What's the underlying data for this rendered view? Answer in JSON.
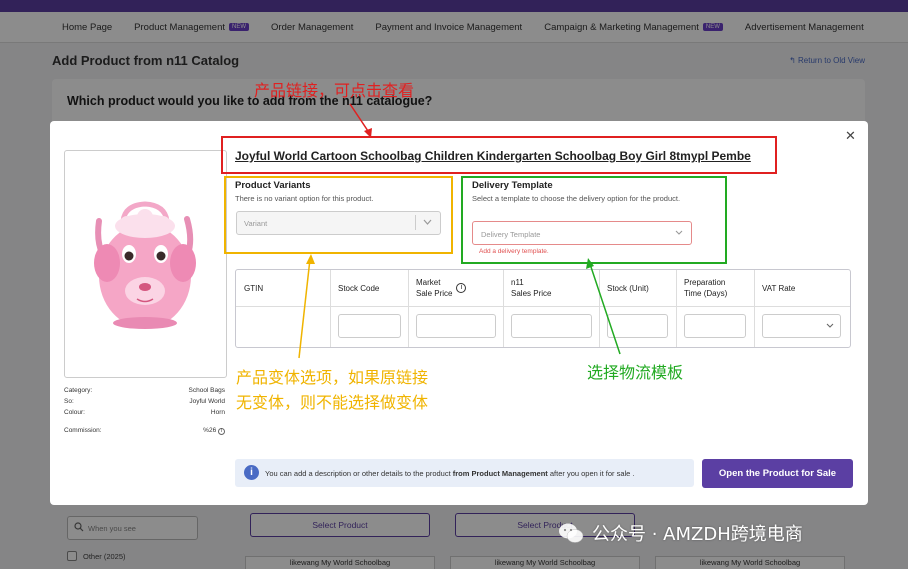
{
  "nav": {
    "items": [
      {
        "label": "Home Page",
        "badge": ""
      },
      {
        "label": "Product Management",
        "badge": "NEW"
      },
      {
        "label": "Order Management",
        "badge": ""
      },
      {
        "label": "Payment and Invoice Management",
        "badge": ""
      },
      {
        "label": "Campaign & Marketing Management",
        "badge": "NEW"
      },
      {
        "label": "Advertisement Management",
        "badge": ""
      }
    ]
  },
  "page": {
    "title": "Add Product from n11 Catalog",
    "return_link": "Return to Old View",
    "question": "Which product would you like to add from the n11 catalogue?"
  },
  "background": {
    "search_placeholder": "When you see",
    "filter_option": "Other (2025)",
    "select_product_label": "Select Product",
    "item_label": "likewang My World Schoolbag"
  },
  "modal": {
    "product_title": "Joyful World Cartoon Schoolbag Children Kindergarten Schoolbag Boy Girl 8tmypl Pembe",
    "meta": [
      {
        "label": "Category:",
        "value": "School Bags"
      },
      {
        "label": "So:",
        "value": "Joyful World"
      },
      {
        "label": "Colour:",
        "value": "Horn"
      },
      {
        "label": "Commission:",
        "value": "%26"
      }
    ],
    "variants": {
      "title": "Product Variants",
      "description": "There is no variant option for this product.",
      "placeholder": "Variant"
    },
    "delivery": {
      "title": "Delivery Template",
      "description": "Select a template to choose the delivery option for the product.",
      "placeholder": "Delivery Template",
      "error": "Add a delivery template."
    },
    "table": {
      "headers": {
        "gtin": "GTIN",
        "stock_code": "Stock Code",
        "market_price_line1": "Market",
        "market_price_line2": "Sale Price",
        "n11_price_line1": "n11",
        "n11_price_line2": "Sales Price",
        "stock_unit": "Stock (Unit)",
        "prep_line1": "Preparation",
        "prep_line2": "Time (Days)",
        "vat_rate": "VAT Rate"
      }
    },
    "info": {
      "text_before": "You can add a description or other details to the product ",
      "text_bold": "from Product Management",
      "text_after": " after you open it for sale ."
    },
    "open_button": "Open the Product for Sale"
  },
  "annotations": {
    "link": "产品链接，可点击查看",
    "variant_line1": "产品变体选项，如果原链接",
    "variant_line2": "无变体，则不能选择做变体",
    "delivery": "选择物流模板"
  },
  "watermark": "公众号 · AMZDH跨境电商",
  "colors": {
    "brand_purple": "#5b3fa3",
    "annotation_red": "#e02020",
    "annotation_orange": "#f0b400",
    "annotation_green": "#22aa22"
  }
}
